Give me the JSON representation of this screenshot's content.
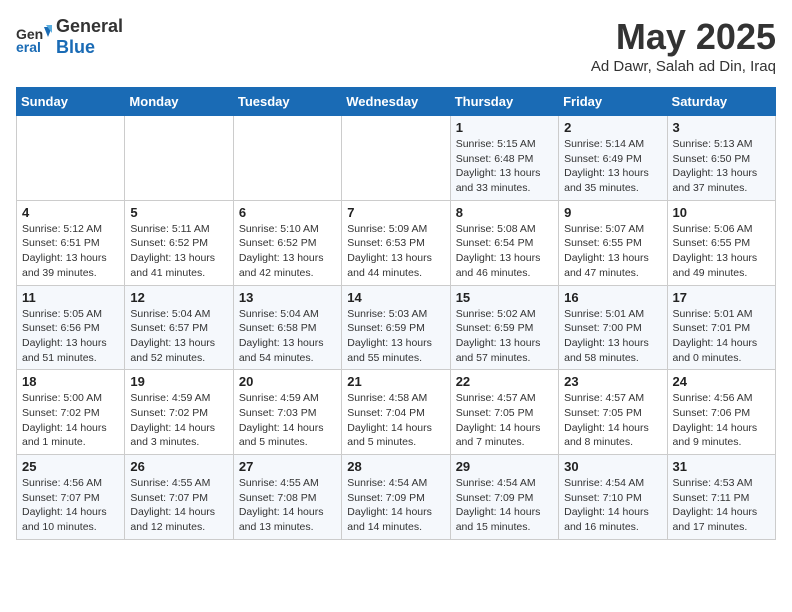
{
  "header": {
    "logo_line1": "General",
    "logo_line2": "Blue",
    "month_title": "May 2025",
    "subtitle": "Ad Dawr, Salah ad Din, Iraq"
  },
  "days_of_week": [
    "Sunday",
    "Monday",
    "Tuesday",
    "Wednesday",
    "Thursday",
    "Friday",
    "Saturday"
  ],
  "weeks": [
    [
      {
        "day": "",
        "info": ""
      },
      {
        "day": "",
        "info": ""
      },
      {
        "day": "",
        "info": ""
      },
      {
        "day": "",
        "info": ""
      },
      {
        "day": "1",
        "info": "Sunrise: 5:15 AM\nSunset: 6:48 PM\nDaylight: 13 hours\nand 33 minutes."
      },
      {
        "day": "2",
        "info": "Sunrise: 5:14 AM\nSunset: 6:49 PM\nDaylight: 13 hours\nand 35 minutes."
      },
      {
        "day": "3",
        "info": "Sunrise: 5:13 AM\nSunset: 6:50 PM\nDaylight: 13 hours\nand 37 minutes."
      }
    ],
    [
      {
        "day": "4",
        "info": "Sunrise: 5:12 AM\nSunset: 6:51 PM\nDaylight: 13 hours\nand 39 minutes."
      },
      {
        "day": "5",
        "info": "Sunrise: 5:11 AM\nSunset: 6:52 PM\nDaylight: 13 hours\nand 41 minutes."
      },
      {
        "day": "6",
        "info": "Sunrise: 5:10 AM\nSunset: 6:52 PM\nDaylight: 13 hours\nand 42 minutes."
      },
      {
        "day": "7",
        "info": "Sunrise: 5:09 AM\nSunset: 6:53 PM\nDaylight: 13 hours\nand 44 minutes."
      },
      {
        "day": "8",
        "info": "Sunrise: 5:08 AM\nSunset: 6:54 PM\nDaylight: 13 hours\nand 46 minutes."
      },
      {
        "day": "9",
        "info": "Sunrise: 5:07 AM\nSunset: 6:55 PM\nDaylight: 13 hours\nand 47 minutes."
      },
      {
        "day": "10",
        "info": "Sunrise: 5:06 AM\nSunset: 6:55 PM\nDaylight: 13 hours\nand 49 minutes."
      }
    ],
    [
      {
        "day": "11",
        "info": "Sunrise: 5:05 AM\nSunset: 6:56 PM\nDaylight: 13 hours\nand 51 minutes."
      },
      {
        "day": "12",
        "info": "Sunrise: 5:04 AM\nSunset: 6:57 PM\nDaylight: 13 hours\nand 52 minutes."
      },
      {
        "day": "13",
        "info": "Sunrise: 5:04 AM\nSunset: 6:58 PM\nDaylight: 13 hours\nand 54 minutes."
      },
      {
        "day": "14",
        "info": "Sunrise: 5:03 AM\nSunset: 6:59 PM\nDaylight: 13 hours\nand 55 minutes."
      },
      {
        "day": "15",
        "info": "Sunrise: 5:02 AM\nSunset: 6:59 PM\nDaylight: 13 hours\nand 57 minutes."
      },
      {
        "day": "16",
        "info": "Sunrise: 5:01 AM\nSunset: 7:00 PM\nDaylight: 13 hours\nand 58 minutes."
      },
      {
        "day": "17",
        "info": "Sunrise: 5:01 AM\nSunset: 7:01 PM\nDaylight: 14 hours\nand 0 minutes."
      }
    ],
    [
      {
        "day": "18",
        "info": "Sunrise: 5:00 AM\nSunset: 7:02 PM\nDaylight: 14 hours\nand 1 minute."
      },
      {
        "day": "19",
        "info": "Sunrise: 4:59 AM\nSunset: 7:02 PM\nDaylight: 14 hours\nand 3 minutes."
      },
      {
        "day": "20",
        "info": "Sunrise: 4:59 AM\nSunset: 7:03 PM\nDaylight: 14 hours\nand 5 minutes."
      },
      {
        "day": "21",
        "info": "Sunrise: 4:58 AM\nSunset: 7:04 PM\nDaylight: 14 hours\nand 5 minutes."
      },
      {
        "day": "22",
        "info": "Sunrise: 4:57 AM\nSunset: 7:05 PM\nDaylight: 14 hours\nand 7 minutes."
      },
      {
        "day": "23",
        "info": "Sunrise: 4:57 AM\nSunset: 7:05 PM\nDaylight: 14 hours\nand 8 minutes."
      },
      {
        "day": "24",
        "info": "Sunrise: 4:56 AM\nSunset: 7:06 PM\nDaylight: 14 hours\nand 9 minutes."
      }
    ],
    [
      {
        "day": "25",
        "info": "Sunrise: 4:56 AM\nSunset: 7:07 PM\nDaylight: 14 hours\nand 10 minutes."
      },
      {
        "day": "26",
        "info": "Sunrise: 4:55 AM\nSunset: 7:07 PM\nDaylight: 14 hours\nand 12 minutes."
      },
      {
        "day": "27",
        "info": "Sunrise: 4:55 AM\nSunset: 7:08 PM\nDaylight: 14 hours\nand 13 minutes."
      },
      {
        "day": "28",
        "info": "Sunrise: 4:54 AM\nSunset: 7:09 PM\nDaylight: 14 hours\nand 14 minutes."
      },
      {
        "day": "29",
        "info": "Sunrise: 4:54 AM\nSunset: 7:09 PM\nDaylight: 14 hours\nand 15 minutes."
      },
      {
        "day": "30",
        "info": "Sunrise: 4:54 AM\nSunset: 7:10 PM\nDaylight: 14 hours\nand 16 minutes."
      },
      {
        "day": "31",
        "info": "Sunrise: 4:53 AM\nSunset: 7:11 PM\nDaylight: 14 hours\nand 17 minutes."
      }
    ]
  ]
}
